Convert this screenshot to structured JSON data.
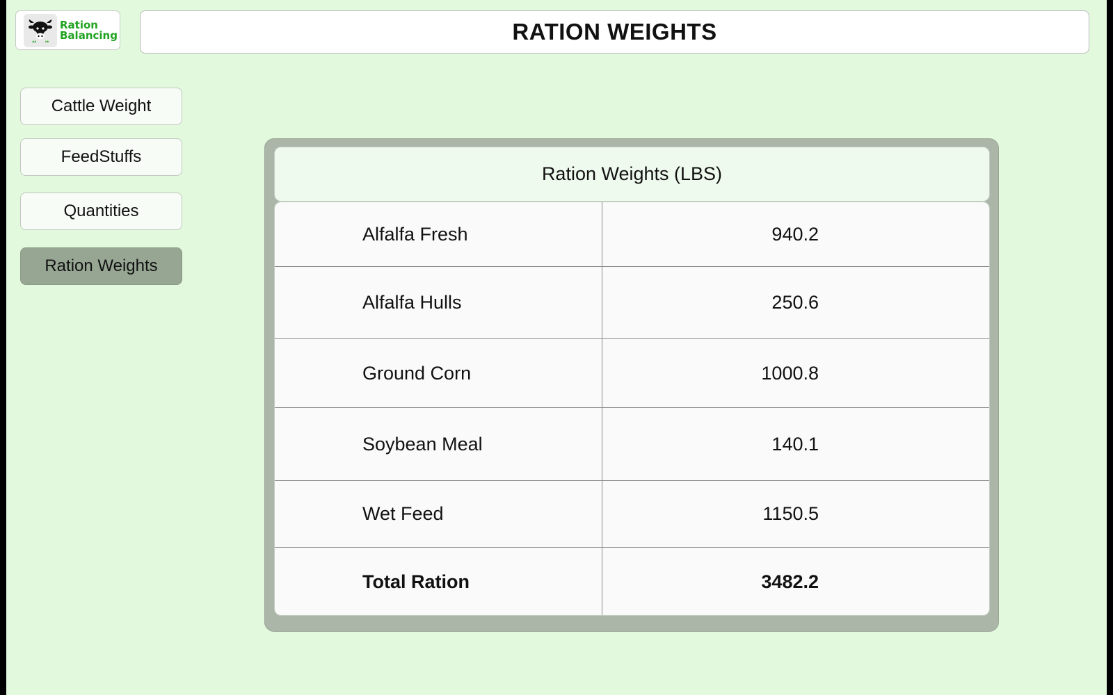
{
  "app": {
    "logo_line1": "Ration",
    "logo_line2": "Balancing",
    "logo_icon": "cow-icon",
    "accent_color": "#1fa31f"
  },
  "header": {
    "title": "RATION WEIGHTS"
  },
  "sidebar": {
    "items": [
      {
        "label": "Cattle Weight",
        "active": false
      },
      {
        "label": "FeedStuffs",
        "active": false
      },
      {
        "label": "Quantities",
        "active": false
      },
      {
        "label": "Ration Weights",
        "active": true
      }
    ]
  },
  "table": {
    "title": "Ration Weights (LBS)",
    "rows": [
      {
        "name": "Alfalfa Fresh",
        "value": "940.2"
      },
      {
        "name": "Alfalfa Hulls",
        "value": "250.6"
      },
      {
        "name": "Ground Corn",
        "value": "1000.8"
      },
      {
        "name": "Soybean Meal",
        "value": "140.1"
      },
      {
        "name": "Wet Feed",
        "value": "1150.5"
      }
    ],
    "total": {
      "name": "Total Ration",
      "value": "3482.2"
    }
  },
  "colors": {
    "background": "#e2f9dd",
    "active_nav": "#97a693",
    "panel": "#abb6a8"
  }
}
